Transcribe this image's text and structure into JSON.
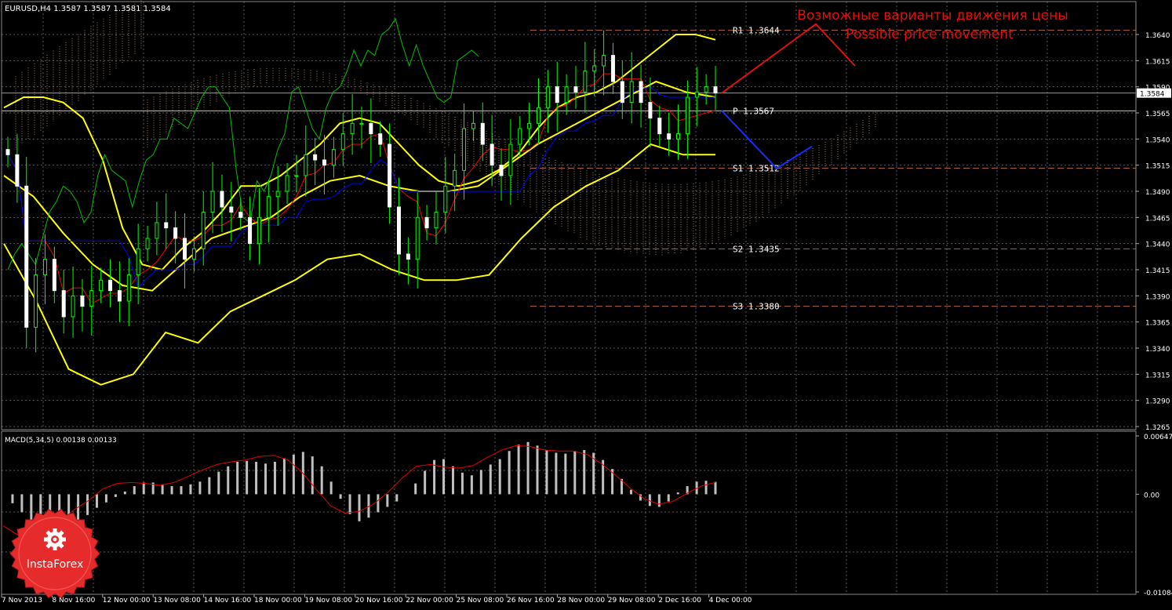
{
  "window": {
    "main_title": "EURUSD,H4  1.3587 1.3587 1.3581 1.3584",
    "macd_title": "MACD(5,34,5) 0.00138 0.00133"
  },
  "annotations": {
    "ru": "Возможные варианты движения цены",
    "en": "Possible price movement"
  },
  "logo": {
    "text": "InstaForex",
    "icon": "gear-badge-icon"
  },
  "colors": {
    "background": "#000000",
    "grid": "#5a5a5a",
    "bull": "#00ff00",
    "bear": "#ffffff",
    "bollinger": "#ffff00",
    "tenkan": "#ff0000",
    "kijun": "#0000ff",
    "chikou": "#00c000",
    "cloud": "#c8966e",
    "level": "#b4643c",
    "forecast_up": "#e01010",
    "forecast_down": "#1030ff",
    "macd_hist": "#c0c0c0",
    "macd_signal": "#e00000",
    "logo_red": "#e52b2b"
  },
  "chart_data": [
    {
      "type": "candlestick",
      "symbol": "EURUSD",
      "timeframe": "H4",
      "ohlc_last": {
        "open": 1.3587,
        "high": 1.3587,
        "low": 1.3581,
        "close": 1.3584
      },
      "current_price": "1.3584",
      "ylim": [
        1.3265,
        1.3655
      ],
      "y_ticks": [
        "1.3640",
        "1.3615",
        "1.3590",
        "1.3565",
        "1.3540",
        "1.3515",
        "1.3490",
        "1.3465",
        "1.3440",
        "1.3415",
        "1.3390",
        "1.3365",
        "1.3340",
        "1.3315",
        "1.3290",
        "1.3265"
      ],
      "x_ticks": [
        "7 Nov 2013",
        "8 Nov 16:00",
        "12 Nov 00:00",
        "13 Nov 08:00",
        "14 Nov 16:00",
        "18 Nov 00:00",
        "19 Nov 08:00",
        "20 Nov 16:00",
        "22 Nov 00:00",
        "25 Nov 08:00",
        "26 Nov 16:00",
        "28 Nov 00:00",
        "29 Nov 08:00",
        "2 Dec 16:00",
        "4 Dec 00:00"
      ],
      "levels": [
        {
          "name": "R1",
          "label": "R1 1.3644",
          "value": 1.3644
        },
        {
          "name": "P",
          "label": "P 1.3567",
          "value": 1.3567
        },
        {
          "name": "S1",
          "label": "S1 1.3512",
          "value": 1.3512
        },
        {
          "name": "S2",
          "label": "S2 1.3435",
          "value": 1.3435
        },
        {
          "name": "S3",
          "label": "S3 1.3380",
          "value": 1.338
        }
      ],
      "close_series": [
        1.3525,
        1.3495,
        1.336,
        1.341,
        1.3425,
        1.3395,
        1.337,
        1.339,
        1.338,
        1.3395,
        1.3405,
        1.3395,
        1.3385,
        1.341,
        1.3435,
        1.3445,
        1.346,
        1.3455,
        1.3445,
        1.3425,
        1.3435,
        1.347,
        1.349,
        1.3475,
        1.347,
        1.3465,
        1.344,
        1.3465,
        1.3485,
        1.349,
        1.3505,
        1.3505,
        1.3525,
        1.352,
        1.3515,
        1.353,
        1.3545,
        1.3555,
        1.3555,
        1.3545,
        1.3535,
        1.3475,
        1.343,
        1.3425,
        1.3465,
        1.3455,
        1.347,
        1.3495,
        1.351,
        1.355,
        1.3555,
        1.3535,
        1.3515,
        1.3505,
        1.3535,
        1.355,
        1.3555,
        1.357,
        1.359,
        1.3575,
        1.359,
        1.3585,
        1.3605,
        1.361,
        1.362,
        1.3595,
        1.3575,
        1.3595,
        1.3575,
        1.356,
        1.3545,
        1.354,
        1.3545,
        1.358,
        1.3585,
        1.359,
        1.3584
      ],
      "bollinger": {
        "upper": [
          1.357,
          1.358,
          1.358,
          1.3575,
          1.356,
          1.352,
          1.3455,
          1.342,
          1.3415,
          1.3435,
          1.345,
          1.347,
          1.3495,
          1.3495,
          1.3505,
          1.352,
          1.3535,
          1.3555,
          1.356,
          1.3555,
          1.3535,
          1.3515,
          1.35,
          1.3495,
          1.35,
          1.351,
          1.3525,
          1.355,
          1.357,
          1.358,
          1.3585,
          1.3595,
          1.361,
          1.3625,
          1.364,
          1.364,
          1.3635
        ],
        "middle": [
          1.3505,
          1.3485,
          1.345,
          1.342,
          1.34,
          1.3395,
          1.342,
          1.3445,
          1.3455,
          1.3465,
          1.3485,
          1.35,
          1.3505,
          1.3495,
          1.349,
          1.349,
          1.3495,
          1.3515,
          1.3535,
          1.355,
          1.3565,
          1.358,
          1.3595,
          1.3585,
          1.358
        ],
        "lower": [
          1.344,
          1.3385,
          1.332,
          1.3305,
          1.3315,
          1.3355,
          1.3345,
          1.3375,
          1.339,
          1.3405,
          1.3425,
          1.343,
          1.3415,
          1.3405,
          1.3405,
          1.341,
          1.3445,
          1.3475,
          1.3495,
          1.351,
          1.3535,
          1.3525,
          1.3525
        ]
      },
      "forecast": {
        "up_path": [
          1.3584,
          1.365,
          1.361
        ],
        "down_path": [
          1.3567,
          1.3512,
          1.3533
        ]
      }
    },
    {
      "type": "bar",
      "indicator": "MACD(5,34,5)",
      "main_value": 0.00138,
      "signal_value": 0.00133,
      "ylim": [
        -0.01084,
        0.00647
      ],
      "y_ticks": [
        "0.00647",
        "0.00",
        "-0.01084"
      ],
      "histogram": [
        0.0,
        -0.001,
        -0.002,
        -0.0033,
        -0.004,
        -0.0045,
        -0.0042,
        -0.0036,
        -0.003,
        -0.0023,
        -0.0015,
        -0.0009,
        -0.0003,
        0.0003,
        0.0009,
        0.0013,
        0.0013,
        0.0011,
        0.0009,
        0.0009,
        0.0011,
        0.0014,
        0.0019,
        0.0025,
        0.0031,
        0.0036,
        0.0037,
        0.0036,
        0.0034,
        0.0036,
        0.004,
        0.0044,
        0.0047,
        0.0042,
        0.0031,
        0.0014,
        -0.0005,
        -0.0022,
        -0.003,
        -0.0026,
        -0.002,
        -0.0014,
        -0.0008,
        0.0,
        0.0012,
        0.0026,
        0.0038,
        0.0039,
        0.0031,
        0.0024,
        0.0021,
        0.0027,
        0.0033,
        0.0039,
        0.0048,
        0.0055,
        0.0058,
        0.0054,
        0.0049,
        0.0046,
        0.0045,
        0.0048,
        0.0049,
        0.0046,
        0.0038,
        0.0028,
        0.0017,
        0.0005,
        -0.0007,
        -0.0013,
        -0.0014,
        -0.0008,
        0.0002,
        0.0009,
        0.0014,
        0.0015,
        0.00138
      ],
      "signal": [
        -0.0035,
        -0.0045,
        -0.0048,
        -0.0042,
        -0.003,
        -0.0017,
        -0.0007,
        0.0006,
        0.0012,
        0.0013,
        0.0012,
        0.001,
        0.0013,
        0.002,
        0.0027,
        0.0033,
        0.0036,
        0.0038,
        0.0042,
        0.0043,
        0.0038,
        0.0024,
        0.0005,
        -0.0013,
        -0.0021,
        -0.0019,
        -0.0011,
        0.0002,
        0.0018,
        0.0031,
        0.0033,
        0.003,
        0.0029,
        0.0032,
        0.0041,
        0.0049,
        0.0054,
        0.0053,
        0.0049,
        0.0048,
        0.0048,
        0.0044,
        0.0034,
        0.0021,
        0.0007,
        -0.0005,
        -0.0011,
        -0.0008,
        0.0001,
        0.0009,
        0.00133
      ]
    }
  ]
}
